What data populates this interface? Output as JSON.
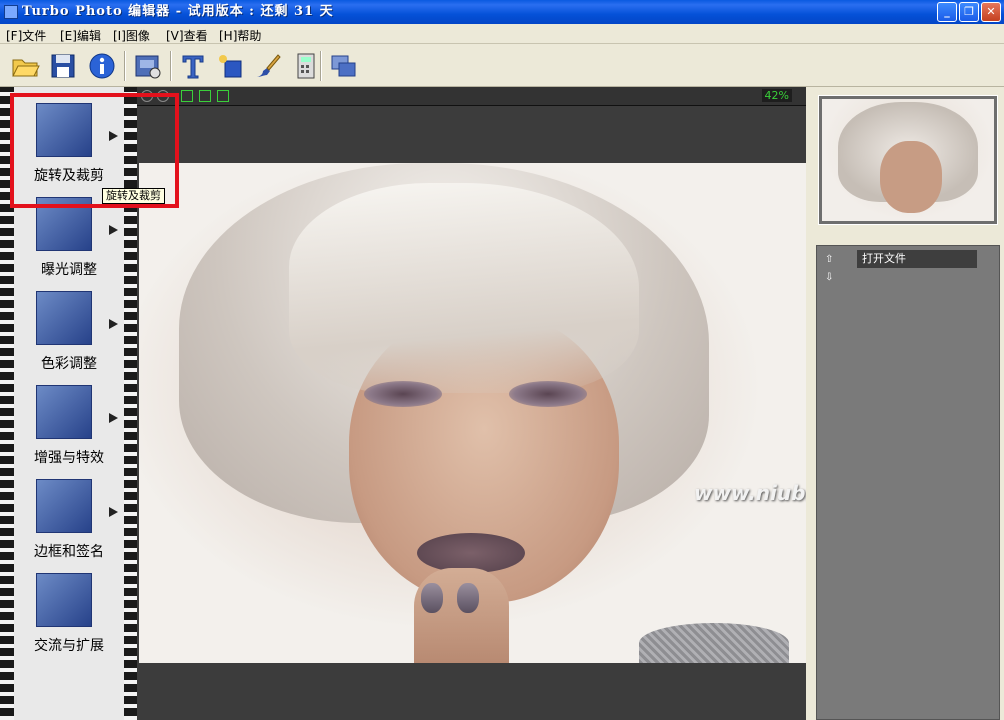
{
  "window": {
    "title": "Turbo Photo 编辑器 - 试用版本 : 还剩 31 天",
    "min_glyph": "_",
    "max_glyph": "❐",
    "close_glyph": "✕"
  },
  "menu": [
    {
      "label": "[F]文件"
    },
    {
      "label": "[E]编辑"
    },
    {
      "label": "[I]图像"
    },
    {
      "label": "[V]查看"
    },
    {
      "label": "[H]帮助"
    }
  ],
  "toolbar": [
    "open-folder-icon",
    "save-disk-icon",
    "info-icon",
    "scan-icon",
    "text-icon",
    "crop-shapes-icon",
    "brush-icon",
    "calculator-icon",
    "batch-icon"
  ],
  "tools": [
    {
      "label": "旋转及裁剪",
      "icon": "rotate-crop-icon",
      "has_arrow": true
    },
    {
      "label": "曝光调整",
      "icon": "exposure-icon",
      "has_arrow": true
    },
    {
      "label": "色彩调整",
      "icon": "color-adjust-icon",
      "has_arrow": true
    },
    {
      "label": "增强与特效",
      "icon": "enhance-effects-icon",
      "has_arrow": true
    },
    {
      "label": "边框和签名",
      "icon": "frame-signature-icon",
      "has_arrow": true
    },
    {
      "label": "交流与扩展",
      "icon": "share-extend-icon",
      "has_arrow": false
    }
  ],
  "tooltip": "旋转及裁剪",
  "viewer": {
    "zoom": "42%",
    "watermark": "www.niubb.net"
  },
  "history": {
    "items": [
      "打开文件"
    ],
    "up_glyph": "⇧",
    "down_glyph": "⇩"
  },
  "colors": {
    "title_bar": "#0551d8",
    "highlight": "#e3111c",
    "zoom_text": "#3ad03a"
  }
}
